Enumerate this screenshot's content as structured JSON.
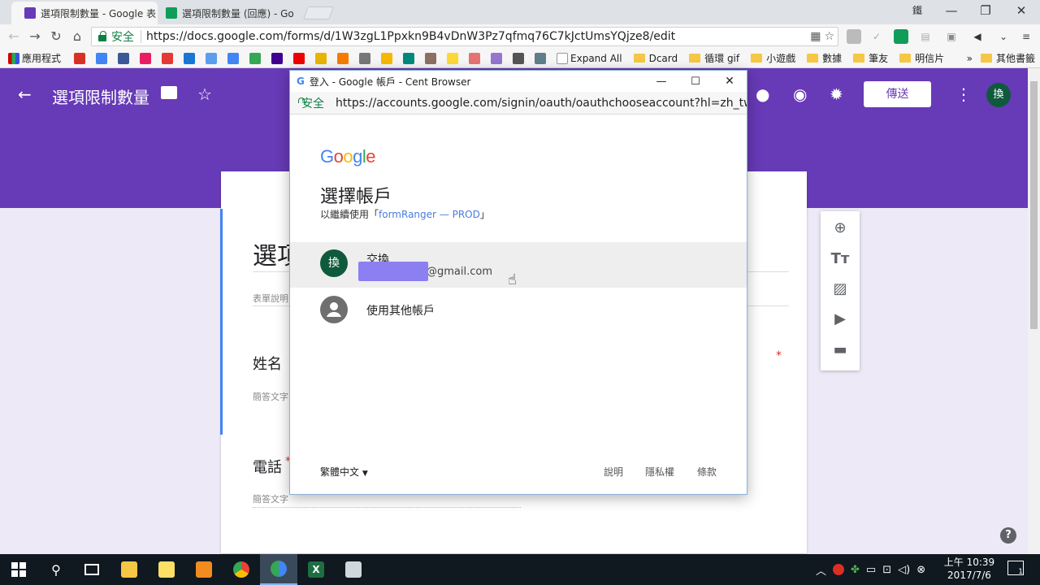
{
  "tabs": [
    {
      "title": "選項限制數量 - Google 表",
      "color": "#673ab7"
    },
    {
      "title": "選項限制數量 (回應) - Go",
      "color": "#0f9d58"
    }
  ],
  "tab_close": "✕",
  "window_controls": {
    "user": "鐵",
    "minimize": "—",
    "restore": "❐",
    "close": "✕"
  },
  "address": {
    "secure": "安全",
    "url": "https://docs.google.com/forms/d/1W3zgL1Ppxkn9B4vDnW3Pz7qfmq76C7kJctUmsYQjze8/edit"
  },
  "bookmarks": {
    "apps": "應用程式",
    "expand_all": "Expand All",
    "folders": [
      "Dcard",
      "循環 gif",
      "小遊戲",
      "數據",
      "筆友",
      "明信片"
    ],
    "others": "其他書籤",
    "more": "»"
  },
  "form": {
    "title": "選項限制數量",
    "send": "傳送",
    "avatar": "換",
    "form_title_partial": "選項",
    "form_desc": "表單說明",
    "q1": "姓名",
    "q1_hint": "簡答文字",
    "required": "*",
    "q2": "電話",
    "q2_req": "*",
    "q2_hint": "簡答文字",
    "help": "?"
  },
  "popup": {
    "window_title": "登入 - Google 帳戶 - Cent Browser",
    "secure": "安全",
    "url": "https://accounts.google.com/signin/oauth/oauthchooseaccount?hl=zh_tw&clie",
    "logo": "Google",
    "heading": "選擇帳戶",
    "continue_prefix": "以繼續使用「",
    "app_name": "formRanger — PROD",
    "continue_suffix": "」",
    "account_name": "交換",
    "account_email": "@gmail.com",
    "account_avatar": "換",
    "other_account": "使用其他帳戶",
    "language": "繁體中文",
    "help": "說明",
    "privacy": "隱私權",
    "terms": "條款"
  },
  "clock": {
    "time": "上午 10:39",
    "date": "2017/7/6"
  },
  "notifications": "1"
}
